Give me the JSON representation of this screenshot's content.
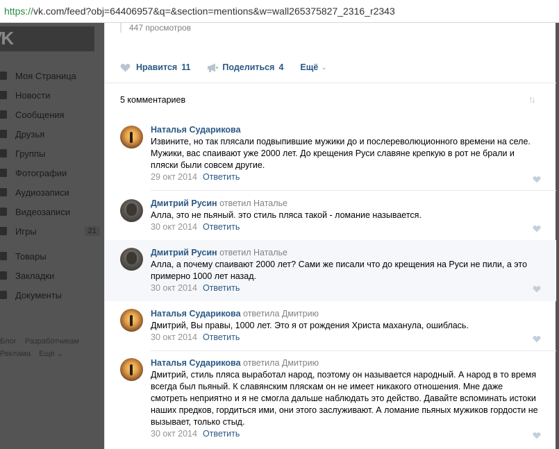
{
  "browser": {
    "url_scheme": "https://",
    "url_rest": "vk.com/feed?obj=64406957&q=&section=mentions&w=wall265375827_2316_r2343"
  },
  "sidebar": {
    "logo": "VK",
    "items": [
      {
        "label": "Моя Страница"
      },
      {
        "label": "Новости"
      },
      {
        "label": "Сообщения"
      },
      {
        "label": "Друзья"
      },
      {
        "label": "Группы"
      },
      {
        "label": "Фотографии"
      },
      {
        "label": "Аудиозаписи"
      },
      {
        "label": "Видеозаписи"
      },
      {
        "label": "Игры",
        "count": "21"
      }
    ],
    "items2": [
      {
        "label": "Товары"
      },
      {
        "label": "Закладки"
      },
      {
        "label": "Документы"
      }
    ],
    "footer": {
      "blog": "Блог",
      "developers": "Разработчикам",
      "ads": "Реклама",
      "more": "Ещё ⌄"
    }
  },
  "post": {
    "views": "447 просмотров",
    "like_label": "Нравится",
    "like_count": "11",
    "share_label": "Поделиться",
    "share_count": "4",
    "more_label": "Ещё"
  },
  "comments_header": "5 комментариев",
  "comments": [
    {
      "author": "Наталья Сударикова",
      "reply_to": "",
      "text": "Извините, но так плясали подвыпившие мужики до и послереволюционного времени на селе. Мужики, вас спаивают уже 2000 лет. До крещения Руси славяне крепкую в рот не брали и пляски были совсем другие.",
      "date": "29 окт 2014",
      "answer": "Ответить"
    },
    {
      "author": "Дмитрий Русин",
      "reply_to": "ответил Наталье",
      "text": "Алла, это не пьяный. это стиль пляса такой - ломание называется.",
      "date": "30 окт 2014",
      "answer": "Ответить"
    },
    {
      "author": "Дмитрий Русин",
      "reply_to": "ответил Наталье",
      "text": "Алла, а почему спаивают 2000 лет? Сами же писали что до крещения на Руси не пили, а это примерно 1000 лет назад.",
      "date": "30 окт 2014",
      "answer": "Ответить"
    },
    {
      "author": "Наталья Сударикова",
      "reply_to": "ответила Дмитрию",
      "text": "Дмитрий, Вы правы, 1000 лет. Это я от рождения Христа маханула, ошиблась.",
      "date": "30 окт 2014",
      "answer": "Ответить"
    },
    {
      "author": "Наталья Сударикова",
      "reply_to": "ответила Дмитрию",
      "text": "Дмитрий, стиль пляса выработал народ, поэтому он называется народный. А народ в то время всегда был пьяный. К славянским пляскам он не имеет никакого отношения. Мне даже смотреть неприятно и я не смогла дальше наблюдать это действо. Давайте вспоминать истоки наших предков, гордиться ими, они этого заслуживают. А ломание пьяных мужиков гордости не вызывает, только стыд.",
      "date": "30 окт 2014",
      "answer": "Ответить"
    }
  ],
  "colors": {
    "link": "#2a5885",
    "muted": "#828282",
    "sidebar_overlay": "#545454"
  }
}
